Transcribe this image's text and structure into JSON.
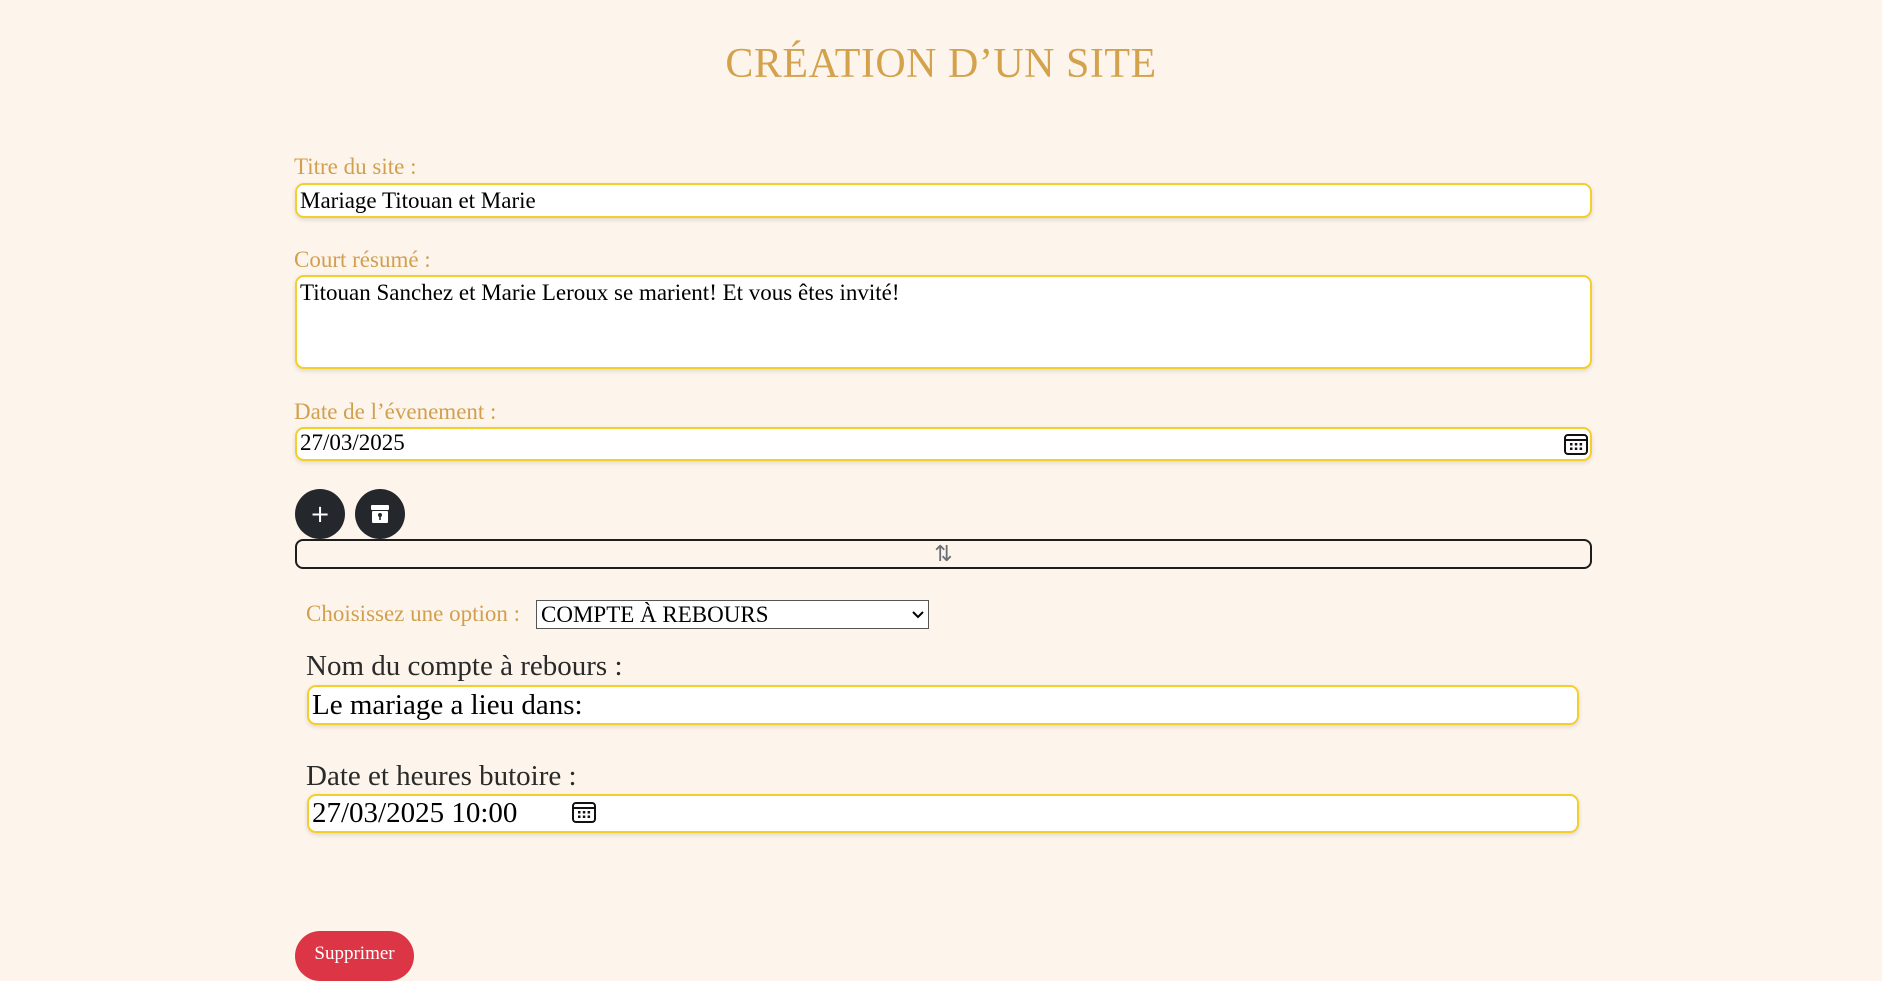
{
  "page": {
    "title": "CRÉATION D’UN SITE"
  },
  "form": {
    "site_title": {
      "label": "Titre du site :",
      "value": "Mariage Titouan et Marie"
    },
    "summary": {
      "label": "Court résumé :",
      "value": "Titouan Sanchez et Marie Leroux se marient! Et vous êtes invité!"
    },
    "event_date": {
      "label": "Date de l’évenement :",
      "value": "27/03/2025",
      "icon": "calendar-icon"
    }
  },
  "actions": {
    "add_symbol": "+",
    "add_icon": "plus-icon",
    "archive_icon": "archive-box-icon",
    "sort_icon": "up-down-arrows-icon",
    "sort_symbol": "⇅"
  },
  "module": {
    "option_label": "Choisissez une option :",
    "option_selected": "COMPTE À REBOURS",
    "countdown_name": {
      "label": "Nom du compte à rebours :",
      "value": "Le mariage a lieu dans:"
    },
    "deadline": {
      "label": "Date et heures butoire :",
      "value": "27/03/2025 10:00",
      "icon": "calendar-icon"
    },
    "delete_label": "Supprimer"
  },
  "colors": {
    "background": "#fdf5ec",
    "accent_gold": "#d4a24c",
    "field_border": "#f4cf2a",
    "dark_button": "#24272b",
    "danger": "#dc3545"
  }
}
